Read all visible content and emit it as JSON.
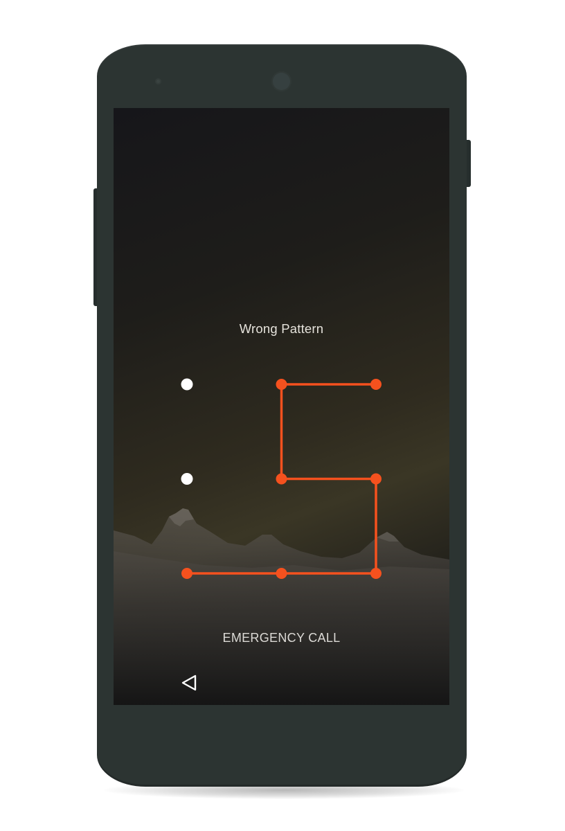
{
  "lockscreen": {
    "status_message": "Wrong Pattern",
    "emergency_label": "EMERGENCY CALL",
    "pattern": {
      "grid_size": 3,
      "selected_cells": [
        [
          0,
          1
        ],
        [
          0,
          2
        ],
        [
          1,
          1
        ],
        [
          1,
          2
        ],
        [
          2,
          0
        ],
        [
          2,
          1
        ],
        [
          2,
          2
        ]
      ],
      "path": [
        [
          0,
          2
        ],
        [
          0,
          1
        ],
        [
          1,
          1
        ],
        [
          1,
          2
        ],
        [
          2,
          2
        ],
        [
          2,
          1
        ],
        [
          2,
          0
        ]
      ],
      "error_color": "#f5511e",
      "idle_dot_color": "#ffffff"
    },
    "nav": {
      "back_icon": "back-triangle-icon"
    }
  },
  "device": {
    "body_color": "#2c3432",
    "camera_icon": "front-camera-icon",
    "sensor_icon": "proximity-sensor-icon"
  }
}
